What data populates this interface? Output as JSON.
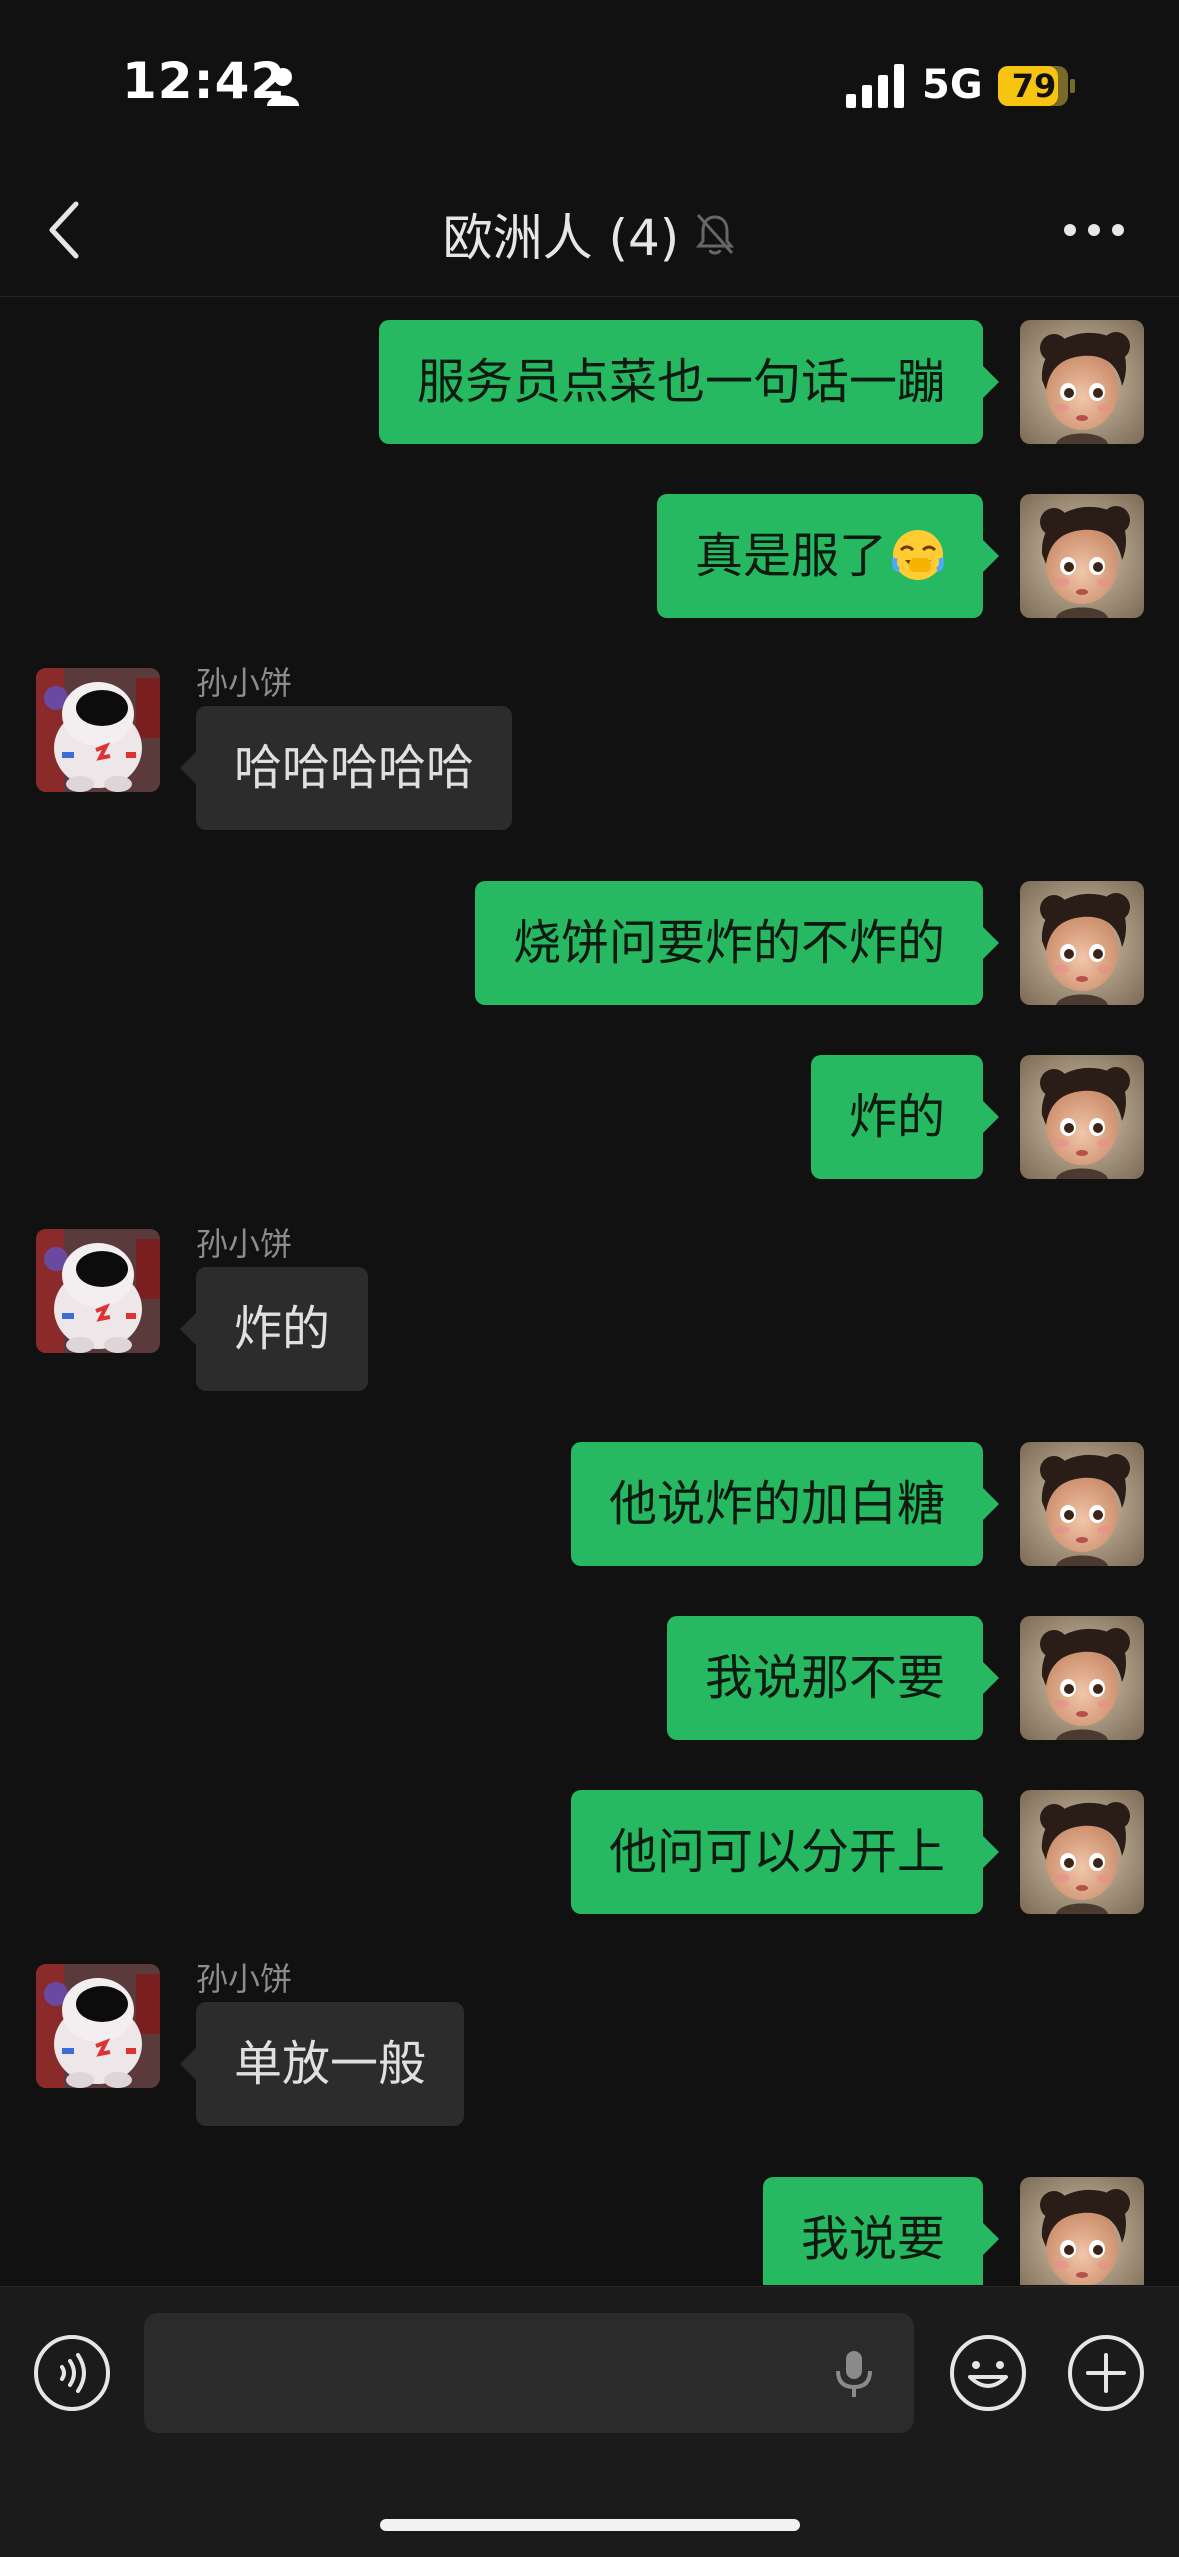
{
  "status_bar": {
    "time": "12:42",
    "network": "5G",
    "battery": "79"
  },
  "header": {
    "title": "欧洲人 (4)"
  },
  "messages": [
    {
      "side": "mine",
      "text": "服务员点菜也一句话一蹦"
    },
    {
      "side": "mine",
      "text": "真是服了",
      "emoji": "face-with-hand-over-mouth-tears"
    },
    {
      "side": "theirs",
      "sender": "孙小饼",
      "text": "哈哈哈哈哈"
    },
    {
      "side": "mine",
      "text": "烧饼问要炸的不炸的"
    },
    {
      "side": "mine",
      "text": "炸的"
    },
    {
      "side": "theirs",
      "sender": "孙小饼",
      "text": "炸的"
    },
    {
      "side": "mine",
      "text": "他说炸的加白糖"
    },
    {
      "side": "mine",
      "text": "我说那不要"
    },
    {
      "side": "mine",
      "text": "他问可以分开上"
    },
    {
      "side": "theirs",
      "sender": "孙小饼",
      "text": "单放一般"
    },
    {
      "side": "mine",
      "text": "我说要"
    }
  ],
  "input_bar": {
    "input_value": ""
  },
  "colors": {
    "my_bubble": "#27b862",
    "their_bubble": "#2c2c2c",
    "background": "#111111",
    "battery": "#f7c511"
  },
  "icons": [
    "person-icon",
    "signal-icon",
    "battery-icon",
    "back-icon",
    "mute-bell-icon",
    "more-icon",
    "voice-icon",
    "mic-icon",
    "emoji-icon",
    "plus-icon"
  ]
}
